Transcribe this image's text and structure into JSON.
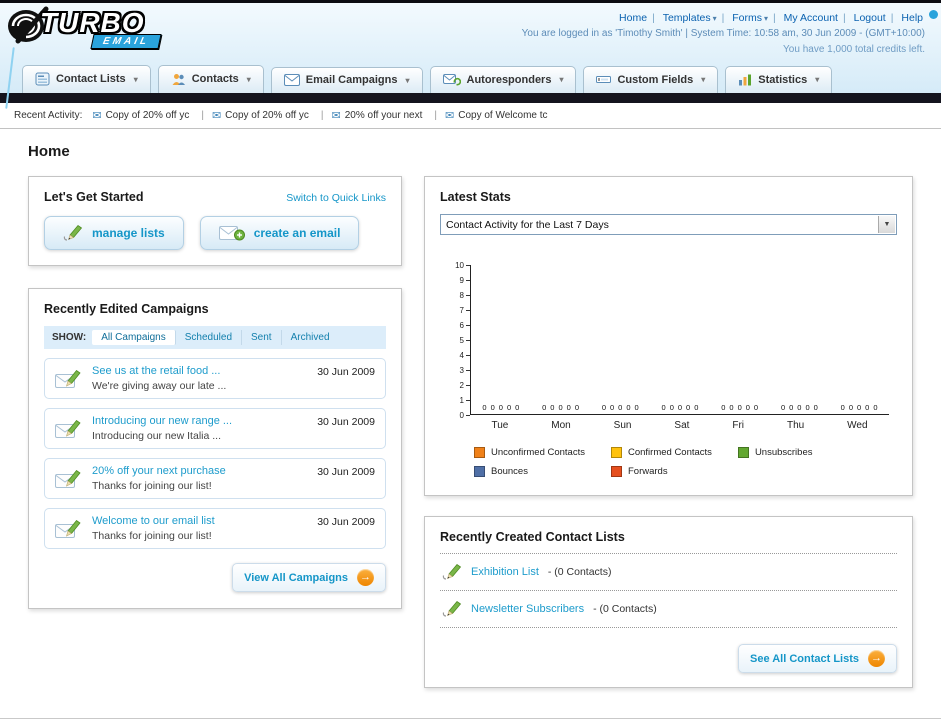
{
  "header": {
    "logo_line1": "TURBO",
    "logo_line2": "EMAIL",
    "links": [
      "Home",
      "Templates",
      "Forms",
      "My Account",
      "Logout",
      "Help"
    ],
    "login_info": "You are logged in as 'Timothy Smith' | System Time: 10:58 am, 30 Jun 2009 - (GMT+10:00)",
    "credits_info": "You have 1,000 total credits left."
  },
  "nav": {
    "tabs": [
      {
        "label": "Contact Lists",
        "icon": "contact-lists-icon"
      },
      {
        "label": "Contacts",
        "icon": "contacts-icon"
      },
      {
        "label": "Email Campaigns",
        "icon": "email-campaigns-icon"
      },
      {
        "label": "Autoresponders",
        "icon": "autoresponders-icon"
      },
      {
        "label": "Custom Fields",
        "icon": "custom-fields-icon"
      },
      {
        "label": "Statistics",
        "icon": "statistics-icon"
      }
    ]
  },
  "recent_activity": {
    "label": "Recent Activity:",
    "items": [
      "Copy of 20% off yc",
      "Copy of 20% off yc",
      "20% off your next",
      "Copy of Welcome tc"
    ]
  },
  "page": {
    "title": "Home"
  },
  "get_started": {
    "title": "Let's Get Started",
    "switch_link": "Switch to Quick Links",
    "manage_lists_label": "manage lists",
    "create_email_label": "create an email"
  },
  "campaigns": {
    "title": "Recently Edited Campaigns",
    "show_label": "SHOW:",
    "filters": [
      "All Campaigns",
      "Scheduled",
      "Sent",
      "Archived"
    ],
    "items": [
      {
        "title": "See us at the retail food ...",
        "subtitle": "We're giving away our late ...",
        "date": "30 Jun 2009"
      },
      {
        "title": "Introducing our new range ...",
        "subtitle": "Introducing our new Italia ...",
        "date": "30 Jun 2009"
      },
      {
        "title": "20% off your next purchase",
        "subtitle": "Thanks for joining our list!",
        "date": "30 Jun 2009"
      },
      {
        "title": "Welcome to our email list",
        "subtitle": "Thanks for joining our list!",
        "date": "30 Jun 2009"
      }
    ],
    "view_all_label": "View All Campaigns"
  },
  "stats": {
    "title": "Latest Stats",
    "period_selected": "Contact Activity for the Last 7 Days",
    "chart_data": {
      "type": "bar",
      "title": "Contact Activity for the Last 7 Days",
      "categories": [
        "Tue",
        "Mon",
        "Sun",
        "Sat",
        "Fri",
        "Thu",
        "Wed"
      ],
      "series": [
        {
          "name": "Unconfirmed Contacts",
          "color": "#F08119",
          "values": [
            0,
            0,
            0,
            0,
            0,
            0,
            0
          ]
        },
        {
          "name": "Confirmed Contacts",
          "color": "#FFC20E",
          "values": [
            0,
            0,
            0,
            0,
            0,
            0,
            0
          ]
        },
        {
          "name": "Unsubscribes",
          "color": "#62A730",
          "values": [
            0,
            0,
            0,
            0,
            0,
            0,
            0
          ]
        },
        {
          "name": "Bounces",
          "color": "#4F6FA6",
          "values": [
            0,
            0,
            0,
            0,
            0,
            0,
            0
          ]
        },
        {
          "name": "Forwards",
          "color": "#E64F1E",
          "values": [
            0,
            0,
            0,
            0,
            0,
            0,
            0
          ]
        }
      ],
      "ylim": [
        0,
        10
      ],
      "legend_position": "bottom",
      "grid": false
    }
  },
  "contact_lists": {
    "title": "Recently Created Contact Lists",
    "items": [
      {
        "name": "Exhibition List",
        "detail": "- (0 Contacts)"
      },
      {
        "name": "Newsletter Subscribers",
        "detail": "- (0 Contacts)"
      }
    ],
    "see_all_label": "See All Contact Lists"
  },
  "colors": {
    "accent_teal": "#1596c8",
    "accent_orange": "#f7941d",
    "dark_bar": "#14141e",
    "header_blue": "#d2e9f7"
  }
}
